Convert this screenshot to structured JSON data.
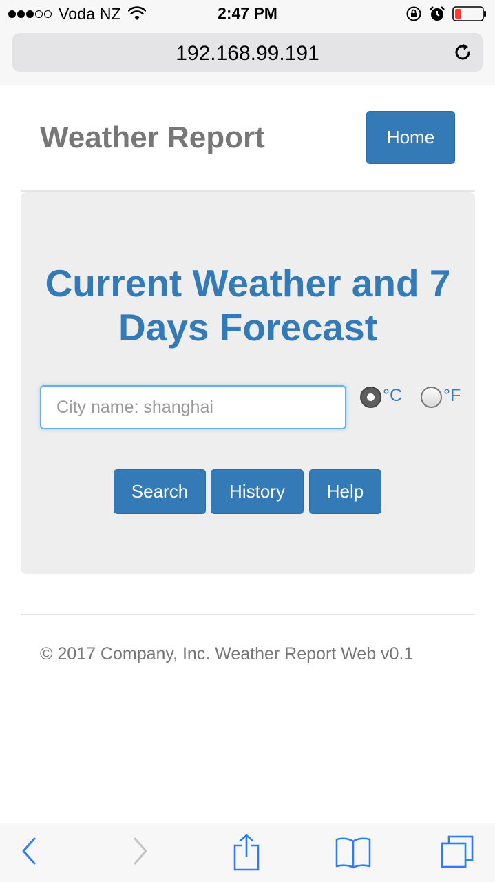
{
  "status_bar": {
    "carrier": "Voda NZ",
    "time": "2:47 PM",
    "signal_bars_filled": 3,
    "signal_bars_total": 5,
    "icons": [
      "wifi-icon",
      "rotation-lock-icon",
      "alarm-icon",
      "battery-low-icon"
    ],
    "battery_color": "#ff3b30"
  },
  "browser": {
    "url": "192.168.99.191",
    "toolbar_icons": [
      "back-icon",
      "forward-icon",
      "share-icon",
      "bookmarks-icon",
      "tabs-icon"
    ],
    "accent": "#2f7cf6"
  },
  "header": {
    "site_title": "Weather Report",
    "home_label": "Home"
  },
  "main": {
    "heading": "Current Weather and 7 Days Forecast",
    "search_input": {
      "placeholder": "City name: shanghai",
      "value": ""
    },
    "units": [
      {
        "label": "°C",
        "checked": true
      },
      {
        "label": "°F",
        "checked": false
      }
    ],
    "buttons": {
      "search": "Search",
      "history": "History",
      "help": "Help"
    }
  },
  "footer": {
    "text": "© 2017 Company, Inc. Weather Report Web v0.1"
  },
  "colors": {
    "primary": "#337ab7",
    "muted_text": "#777777",
    "jumbotron_bg": "#eeeeef"
  }
}
